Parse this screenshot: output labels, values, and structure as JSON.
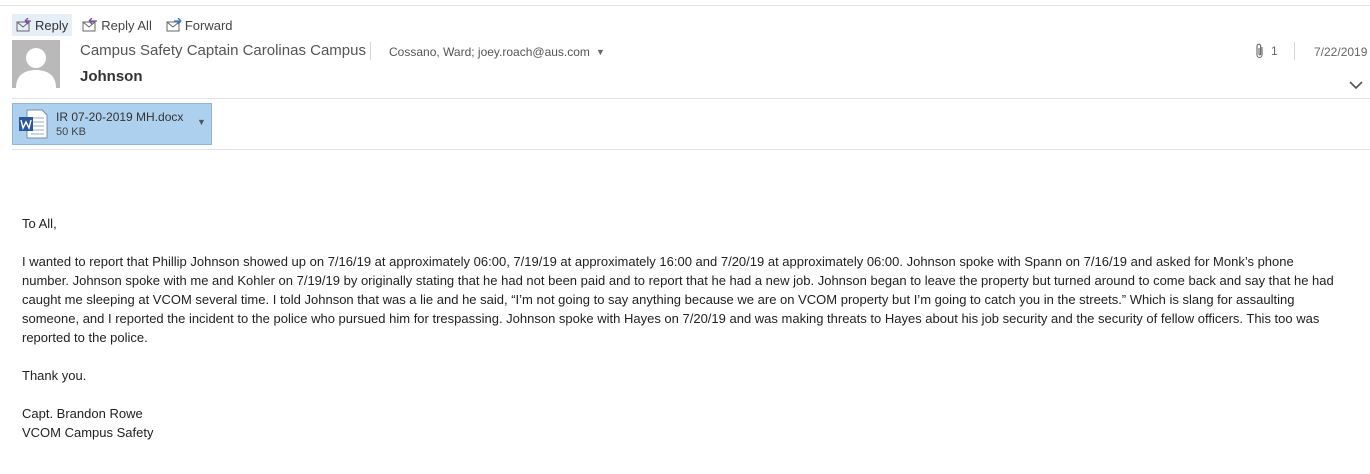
{
  "toolbar": {
    "reply": "Reply",
    "reply_all": "Reply All",
    "forward": "Forward"
  },
  "header": {
    "sender": "Campus Safety Captain Carolinas Campus",
    "subject": "Johnson",
    "recipients": "Cossano, Ward; joey.roach@aus.com",
    "attachment_count": "1",
    "date": "7/22/2019"
  },
  "attachment": {
    "filename": "IR 07-20-2019 MH.docx",
    "size": "50 KB",
    "icon": "word-doc-icon"
  },
  "message": {
    "greeting": "To All,",
    "paragraph": "I wanted to report that Phillip Johnson showed up on 7/16/19 at approximately 06:00, 7/19/19 at approximately 16:00 and 7/20/19 at approximately 06:00. Johnson spoke with Spann on 7/16/19 and asked for Monk’s phone number. Johnson spoke with me and Kohler on 7/19/19 by originally stating that he had not been paid and to report that he had a new job. Johnson began to leave the property but turned around to come back and say that he had caught me sleeping at VCOM several time. I told Johnson that was a lie and he said, “I’m not going to say anything because we are on VCOM property but I’m going to catch you in the streets.” Which is slang for assaulting someone, and I reported the incident to the police who pursued him for trespassing. Johnson spoke with Hayes on 7/20/19 and was making threats to Hayes about his job security and the security of fellow officers.  This too was reported to the police.",
    "thanks": "Thank you.",
    "signature_name": "Capt. Brandon Rowe",
    "signature_org": "VCOM Campus Safety"
  },
  "colors": {
    "attachment_bg": "#aed0ef",
    "reply_highlight": "#e6eef8",
    "word_blue": "#2b579a"
  }
}
